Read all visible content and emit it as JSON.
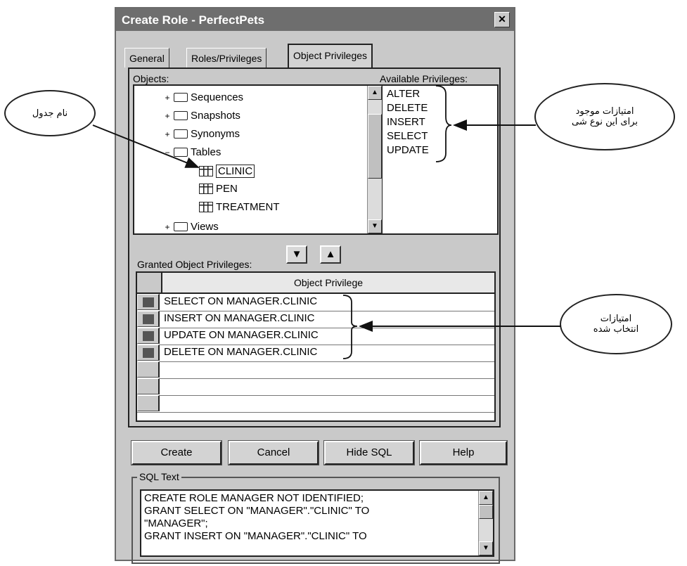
{
  "window": {
    "title": "Create Role - PerfectPets",
    "close_glyph": "✕"
  },
  "tabs": [
    {
      "label": "General"
    },
    {
      "label": "Roles/Privileges"
    },
    {
      "label": "Object Privileges"
    }
  ],
  "objects": {
    "label": "Objects:",
    "tree": [
      {
        "label": "Sequences"
      },
      {
        "label": "Snapshots"
      },
      {
        "label": "Synonyms"
      },
      {
        "label": "Tables"
      },
      {
        "label": "CLINIC"
      },
      {
        "label": "PEN"
      },
      {
        "label": "TREATMENT"
      },
      {
        "label": "Views"
      }
    ],
    "expanders": {
      "plus": "+",
      "minus": "−"
    }
  },
  "available": {
    "label": "Available Privileges:",
    "items": [
      "ALTER",
      "DELETE",
      "INSERT",
      "SELECT",
      "UPDATE"
    ]
  },
  "move_buttons": {
    "down": "▼",
    "up": "▲"
  },
  "granted": {
    "label": "Granted Object Privileges:",
    "column": "Object Privilege",
    "rows": [
      "SELECT ON MANAGER.CLINIC",
      "INSERT ON MANAGER.CLINIC",
      "UPDATE ON MANAGER.CLINIC",
      "DELETE ON MANAGER.CLINIC",
      "",
      "",
      ""
    ]
  },
  "buttons": {
    "create": "Create",
    "cancel": "Cancel",
    "hide_sql": "Hide SQL",
    "help": "Help"
  },
  "sql": {
    "label": "SQL Text",
    "lines": [
      "CREATE ROLE MANAGER NOT IDENTIFIED;",
      "GRANT SELECT ON \"MANAGER\".\"CLINIC\" TO",
      "\"MANAGER\";",
      "GRANT INSERT ON \"MANAGER\".\"CLINIC\" TO"
    ]
  },
  "annotations": {
    "table_name": "نام جدول",
    "available_line1": "امتیازات موجود",
    "available_line2": "برای این نوع شی",
    "granted_line1": "امتیازات",
    "granted_line2": "انتخاب شده"
  },
  "scroll_glyphs": {
    "up": "▲",
    "down": "▼"
  }
}
